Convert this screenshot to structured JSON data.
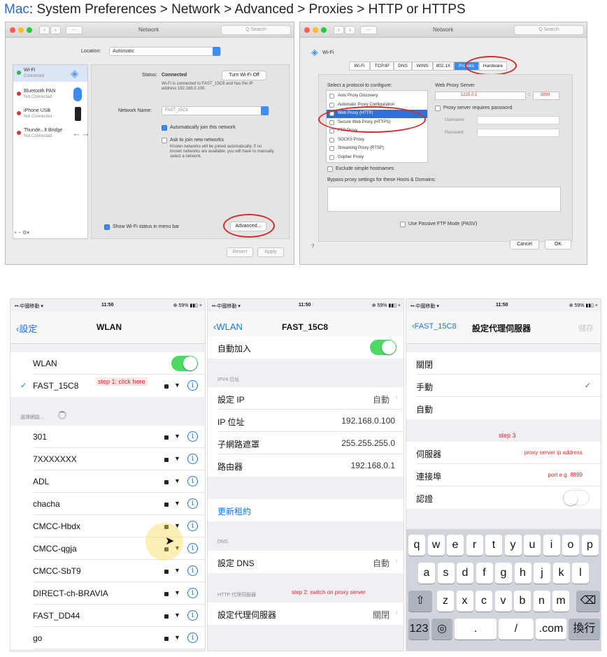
{
  "headline": {
    "mac": "Mac",
    "rest": ": System Preferences > Network > Advanced > Proxies > HTTP or HTTPS"
  },
  "mac_net": {
    "title": "Network",
    "search": "Q Search",
    "location_label": "Location:",
    "location_value": "Automatic",
    "services": [
      {
        "name": "Wi-Fi",
        "status": "Connected",
        "color": "#31b44a"
      },
      {
        "name": "Bluetooth PAN",
        "status": "Not Connected",
        "color": "#d43a3a"
      },
      {
        "name": "iPhone USB",
        "status": "Not Connected",
        "color": "#d43a3a"
      },
      {
        "name": "Thunde...lt Bridge",
        "status": "Not Connected",
        "color": "#d43a3a"
      }
    ],
    "status_label": "Status:",
    "status_value": "Connected",
    "turn_off": "Turn Wi-Fi Off",
    "status_desc": "Wi-Fi is connected to FAST_15C8 and has the IP address 192.168.0.100.",
    "network_name_label": "Network Name:",
    "network_name": "FAST_15C8",
    "auto_join": "Automatically join this network",
    "ask_join": "Ask to join new networks",
    "ask_desc": "Known networks will be joined automatically. If no known networks are available, you will have to manually select a network.",
    "show_wifi": "Show Wi-Fi status in menu bar",
    "advanced": "Advanced...",
    "revert": "Revert",
    "apply": "Apply",
    "bottom_ctrl": "+ − ⚙▾"
  },
  "mac_adv": {
    "title": "Network",
    "search": "Q Search",
    "wifi": "Wi-Fi",
    "tabs": [
      "Wi-Fi",
      "TCP/IP",
      "DNS",
      "WINS",
      "802.1X",
      "Proxies",
      "Hardware"
    ],
    "select_label": "Select a protocol to configure:",
    "protocols": [
      "Auto Proxy Discovery",
      "Automatic Proxy Configuration",
      "Web Proxy (HTTP)",
      "Secure Web Proxy (HTTPS)",
      "FTP Proxy",
      "SOCKS Proxy",
      "Streaming Proxy (RTSP)",
      "Gopher Proxy"
    ],
    "web_proxy_server": "Web Proxy Server",
    "server_value": "1215.0.1",
    "port_value": "8899",
    "requires_pw": "Proxy server requires password",
    "username": "Username:",
    "password": "Password:",
    "exclude": "Exclude simple hostnames",
    "bypass": "Bypass proxy settings for these Hosts & Domains:",
    "pasv": "Use Passive FTP Mode (PASV)",
    "cancel": "Cancel",
    "ok": "OK",
    "help": "?"
  },
  "status_bar": {
    "carrier": "••◦中國移動 ▾",
    "time": "11:50",
    "battery": "⊕ 59% ▮▮▯ +"
  },
  "ios1": {
    "back": "設定",
    "title": "WLAN",
    "wlan_label": "WLAN",
    "connected": "FAST_15C8",
    "check": "✓",
    "step1": "step 1: click here",
    "section": "選擇網路…",
    "networks": [
      "301",
      "7XXXXXXX",
      "ADL",
      "chacha",
      "CMCC-Hbdx",
      "CMCC-qgja",
      "CMCC-SbT9",
      "DIRECT-ch-BRAVIA",
      "FAST_DD44",
      "go"
    ]
  },
  "ios2": {
    "back": "WLAN",
    "title": "FAST_15C8",
    "auto_join": "自動加入",
    "ipv4": "IPV4 位址",
    "config_ip": "設定 IP",
    "auto": "自動",
    "ip_label": "IP 位址",
    "ip": "192.168.0.100",
    "subnet_label": "子網路遮罩",
    "subnet": "255.255.255.0",
    "router_label": "路由器",
    "router": "192.168.0.1",
    "renew": "更新租約",
    "dns": "DNS",
    "config_dns": "設定 DNS",
    "http_proxy": "HTTP 代理伺服器",
    "step2": "step 2: switch on proxy server",
    "config_proxy": "設定代理伺服器",
    "off": "關閉"
  },
  "ios3": {
    "back": "FAST_15C8",
    "title": "設定代理伺服器",
    "save": "儲存",
    "off": "關閉",
    "manual": "手動",
    "auto": "自動",
    "check": "✓",
    "step3": "step 3",
    "server": "伺服器",
    "server_hint": "proxy server ip address",
    "port": "連接埠",
    "port_hint": "port e.g. 8899",
    "auth": "認證",
    "keys_row1": [
      "q",
      "w",
      "e",
      "r",
      "t",
      "y",
      "u",
      "i",
      "o",
      "p"
    ],
    "keys_row2": [
      "a",
      "s",
      "d",
      "f",
      "g",
      "h",
      "j",
      "k",
      "l"
    ],
    "keys_row3": [
      "z",
      "x",
      "c",
      "v",
      "b",
      "n",
      "m"
    ],
    "shift": "⇧",
    "delete": "⌫",
    "num": "123",
    "globe": "◎",
    "dot": ".",
    "slash": "/",
    "com": ".com",
    "go": "換行"
  },
  "colors": {
    "ios_blue": "#1576f5",
    "toggle_green": "#4cd964",
    "annot_red": "#e0262a"
  }
}
